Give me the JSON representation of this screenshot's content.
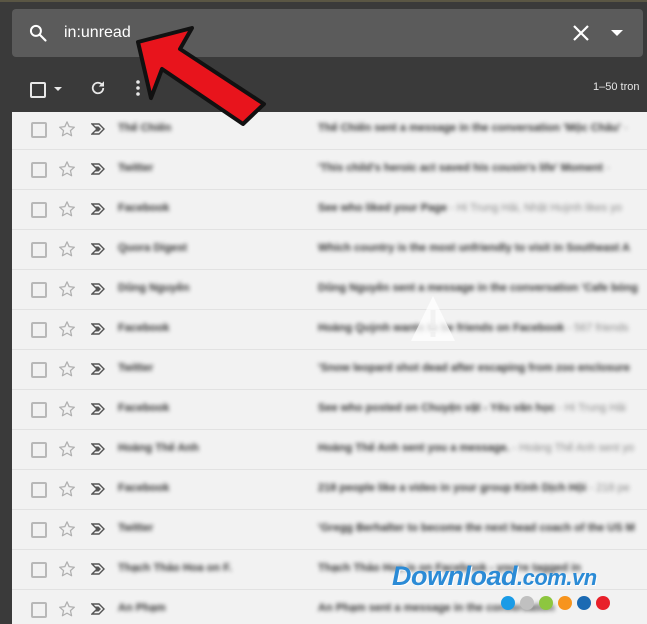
{
  "search": {
    "value": "in:unread"
  },
  "toolbar": {
    "page_count": "1–50 tron"
  },
  "emails": [
    {
      "sender": "Thế Chiến",
      "subject": "Thế Chiến sent a message in the conversation 'Mộc Châu'",
      "snippet": " - "
    },
    {
      "sender": "Twitter",
      "subject": "'This child's heroic act saved his cousin's life' Moment",
      "snippet": " - "
    },
    {
      "sender": "Facebook",
      "subject": "See who liked your Page",
      "snippet": " - Hi Trung Hải, Nhật Huỳnh likes yo"
    },
    {
      "sender": "Quora Digest",
      "subject": "Which country is the most unfriendly to visit in Southeast A",
      "snippet": ""
    },
    {
      "sender": "Dũng Nguyễn",
      "subject": "Dũng Nguyễn sent a message in the conversation 'Cafe bóng",
      "snippet": ""
    },
    {
      "sender": "Facebook",
      "subject": "Hoàng Quỳnh wants to be friends on Facebook",
      "snippet": " - 567 friends"
    },
    {
      "sender": "Twitter",
      "subject": "'Snow leopard shot dead after escaping from zoo enclosure",
      "snippet": ""
    },
    {
      "sender": "Facebook",
      "subject": "See who posted on Chuyện vặt - Yêu văn học",
      "snippet": " - Hi Trung Hải"
    },
    {
      "sender": "Hoàng Thế Anh",
      "subject": "Hoàng Thế Anh sent you a message.",
      "snippet": " - Hoàng Thế Anh sent yo"
    },
    {
      "sender": "Facebook",
      "subject": "218 people like a video in your group Kinh Dịch Hội",
      "snippet": " - 218 pe"
    },
    {
      "sender": "Twitter",
      "subject": "'Gregg Berhalter to become the next head coach of the US M",
      "snippet": ""
    },
    {
      "sender": "Thạch Thảo Hoa on F.",
      "subject": "Thạch Thảo Hoa is on Facebook - you're tagged in",
      "snippet": ""
    },
    {
      "sender": "An Phạm",
      "subject": "An Phạm sent a message in the conversation",
      "snippet": ""
    }
  ],
  "watermark": {
    "brand": "Download",
    "tld": ".com.vn",
    "dot_colors": [
      "#1a9be6",
      "#c0c0c0",
      "#8dc63f",
      "#f7941d",
      "#1b6ab3",
      "#e8202a"
    ]
  },
  "colors": {
    "search_bg": "#5b5b5b",
    "toolbar_bg": "#3a3a3a",
    "list_bg": "#f2f2f2",
    "arrow": "#e8141c"
  }
}
